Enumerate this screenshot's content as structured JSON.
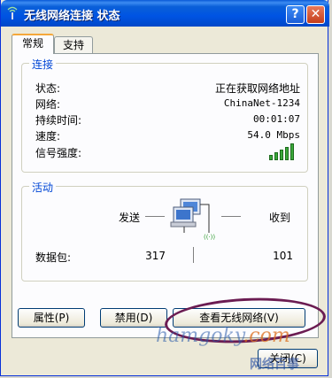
{
  "window": {
    "title": "无线网络连接 状态",
    "help_label": "?",
    "close_label": "✕"
  },
  "tabs": [
    {
      "label": "常规",
      "active": true
    },
    {
      "label": "支持",
      "active": false
    }
  ],
  "connection": {
    "legend": "连接",
    "rows": [
      {
        "label": "状态:",
        "value": "正在获取网络地址"
      },
      {
        "label": "网络:",
        "value": "ChinaNet-1234"
      },
      {
        "label": "持续时间:",
        "value": "00:01:07"
      },
      {
        "label": "速度:",
        "value": "54.0 Mbps"
      },
      {
        "label": "信号强度:",
        "value": ""
      }
    ],
    "signal_icon": "signal-strength-bars",
    "signal_bars": 5
  },
  "activity": {
    "legend": "活动",
    "sent_label": "发送",
    "received_label": "收到",
    "packets_label": "数据包:",
    "packets_sent": "317",
    "packets_received": "101",
    "icon": "network-computers-icon"
  },
  "buttons": {
    "properties": "属性(P)",
    "disable": "禁用(D)",
    "view_networks": "查看无线网络(V)",
    "close": "关闭(C)"
  },
  "watermark": {
    "text": "hamgoky",
    "suffix": ".com",
    "sub": "网络百事"
  },
  "colors": {
    "titlebar": "#0054e3",
    "legend": "#0046d5",
    "signal": "#3aa83a",
    "annotation": "#6b1c52"
  }
}
